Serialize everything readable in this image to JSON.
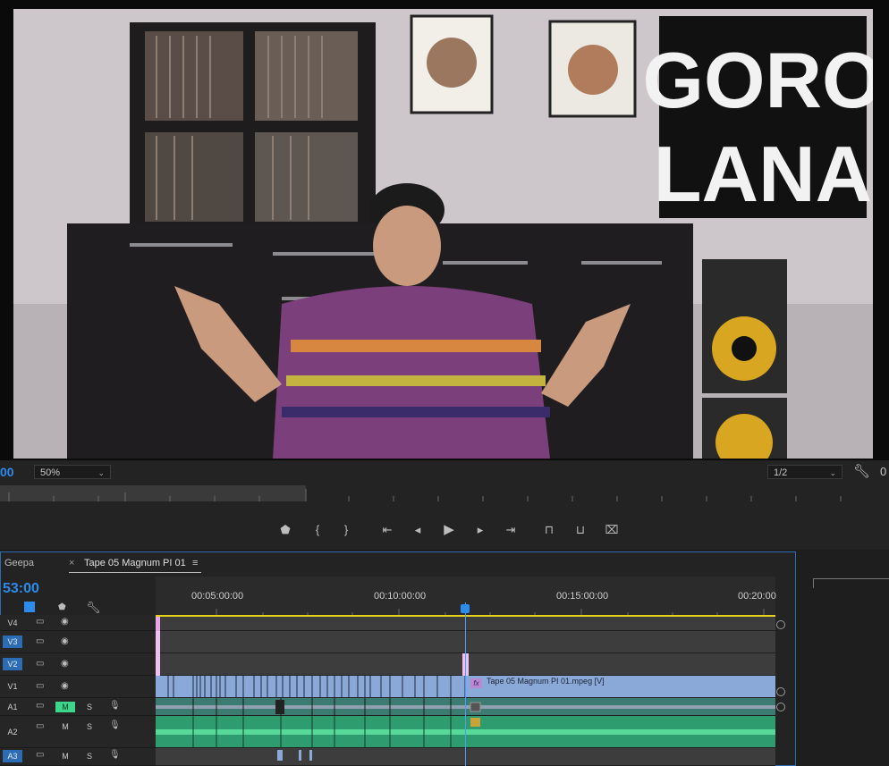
{
  "monitor": {
    "timecode": "00",
    "zoom": "50%",
    "resolution": "1/2",
    "right_timecode": "0"
  },
  "transport": {
    "buttons": [
      "marker",
      "in",
      "out",
      "go-to-in",
      "step-back",
      "play",
      "step-forward",
      "go-to-out",
      "lift",
      "extract",
      "export-frame"
    ]
  },
  "timeline": {
    "tabs": [
      "Geepa",
      "Tape 05 Magnum PI 01"
    ],
    "tab_close": "×",
    "tab_menu": "≡",
    "timecode": "53:00",
    "ruler": [
      "00:05:00:00",
      "00:10:00:00",
      "00:15:00:00",
      "00:20:00"
    ],
    "tracks": {
      "v4": "V4",
      "v3": "V3",
      "v2": "V2",
      "v1": "V1",
      "a1": "A1",
      "a2": "A2",
      "a3": "A3",
      "mute": "M",
      "solo": "S"
    },
    "clip_label": "Tape 05 Magnum PI 01.mpeg [V]",
    "fx": "fx"
  },
  "overlay": {
    "logo_line1": "GORO",
    "logo_line2": "LANA"
  },
  "colors": {
    "accent": "#2d8ceb",
    "video_clip": "#8aa8d8",
    "audio_clip": "#3fbf8a",
    "work_area": "#e6d21a"
  }
}
